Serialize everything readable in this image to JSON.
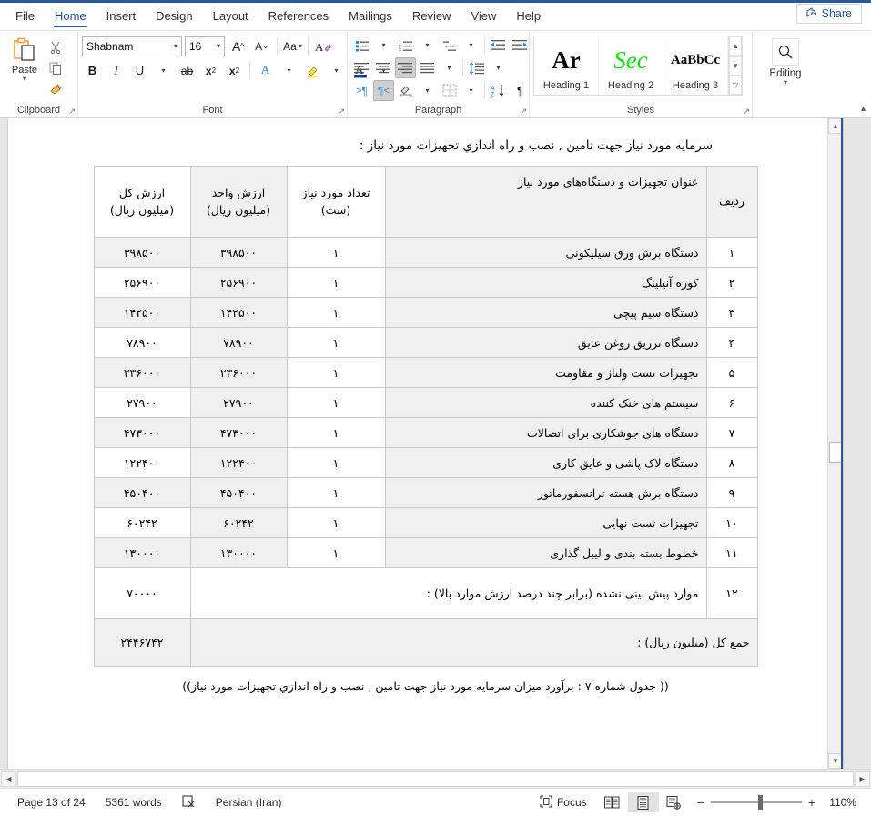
{
  "window": {
    "accent_color": "#2b579a",
    "share_label": "Share",
    "share_icon": "share-icon"
  },
  "tabs": [
    {
      "id": "file",
      "label": "File",
      "active": false
    },
    {
      "id": "home",
      "label": "Home",
      "active": true
    },
    {
      "id": "insert",
      "label": "Insert",
      "active": false
    },
    {
      "id": "design",
      "label": "Design",
      "active": false
    },
    {
      "id": "layout",
      "label": "Layout",
      "active": false
    },
    {
      "id": "references",
      "label": "References",
      "active": false
    },
    {
      "id": "mailings",
      "label": "Mailings",
      "active": false
    },
    {
      "id": "review",
      "label": "Review",
      "active": false
    },
    {
      "id": "view",
      "label": "View",
      "active": false
    },
    {
      "id": "help",
      "label": "Help",
      "active": false
    }
  ],
  "ribbon": {
    "clipboard": {
      "group_label": "Clipboard",
      "paste_label": "Paste",
      "cut_icon": "scissors-icon",
      "copy_icon": "copy-icon",
      "format_painter_icon": "format-painter-icon"
    },
    "font": {
      "group_label": "Font",
      "font_name": "Shabnam",
      "font_size": "16",
      "grow_font": "A^",
      "shrink_font": "Aˇ",
      "change_case": "Aa",
      "clear_formatting_icon": "clear-formatting-icon",
      "bold": "B",
      "italic": "I",
      "underline": "U",
      "strikethrough": "ab",
      "subscript": "x",
      "superscript": "x",
      "text_effects_icon": "text-effects-icon",
      "highlight_icon": "highlight-icon",
      "font_color_icon": "font-color-icon"
    },
    "paragraph": {
      "group_label": "Paragraph",
      "bullets_icon": "bullet-list-icon",
      "numbering_icon": "numbered-list-icon",
      "multilevel_icon": "multilevel-list-icon",
      "decrease_indent_icon": "decrease-indent-icon",
      "increase_indent_icon": "increase-indent-icon",
      "align_left_icon": "align-left-icon",
      "align_center_icon": "align-center-icon",
      "align_right_icon": "align-right-icon",
      "justify_icon": "justify-icon",
      "line_spacing_icon": "line-spacing-icon",
      "ltr_icon": "left-to-right-icon",
      "rtl_icon": "right-to-left-icon",
      "shading_icon": "shading-icon",
      "borders_icon": "borders-icon",
      "sort_icon": "sort-icon",
      "show_marks_icon": "show-paragraph-marks-icon"
    },
    "styles": {
      "group_label": "Styles",
      "items": [
        {
          "preview": "Ar",
          "name": "Heading 1"
        },
        {
          "preview": "Sec",
          "name": "Heading 2"
        },
        {
          "preview": "AaBbCc",
          "name": "Heading 3"
        }
      ]
    },
    "editing": {
      "group_label": "",
      "label": "Editing",
      "icon": "search-icon"
    }
  },
  "document": {
    "title_text": "سرمایه مورد نیاز جهت تامین , نصب و راه اندازي تجهیزات مورد نیاز :",
    "caption": "(( جدول شماره ۷ : برآورد میزان سرمایه مورد نیاز جهت تامین , نصب و راه اندازي تجهیزات مورد نیاز))",
    "table": {
      "headers": {
        "radif": "ردیف",
        "title": "عنوان تجهیزات و دستگاه‌های مورد نیاز",
        "count": "تعداد مورد نیاز (ست)",
        "unit_value": "ارزش واحد (میلیون ریال)",
        "total_value": "ارزش کل (میلیون ریال)"
      },
      "rows": [
        {
          "radif": "۱",
          "title": "دستگاه برش ورق سیلیکونی",
          "count": "۱",
          "unit": "۳۹۸۵۰۰",
          "total": "۳۹۸۵۰۰"
        },
        {
          "radif": "۲",
          "title": "کوره آنیلینگ",
          "count": "۱",
          "unit": "۲۵۶۹۰۰",
          "total": "۲۵۶۹۰۰"
        },
        {
          "radif": "۳",
          "title": "دستگاه سیم پیچی",
          "count": "۱",
          "unit": "۱۴۲۵۰۰",
          "total": "۱۴۲۵۰۰"
        },
        {
          "radif": "۴",
          "title": "دستگاه تزریق روغن عایق",
          "count": "۱",
          "unit": "۷۸۹۰۰",
          "total": "۷۸۹۰۰"
        },
        {
          "radif": "۵",
          "title": "تجهیزات تست ولتاژ و مقاومت",
          "count": "۱",
          "unit": "۲۳۶۰۰۰",
          "total": "۲۳۶۰۰۰"
        },
        {
          "radif": "۶",
          "title": "سیستم های خنک کننده",
          "count": "۱",
          "unit": "۲۷۹۰۰",
          "total": "۲۷۹۰۰"
        },
        {
          "radif": "۷",
          "title": "دستگاه های جوشکاری برای اتصالات",
          "count": "۱",
          "unit": "۴۷۳۰۰۰",
          "total": "۴۷۳۰۰۰"
        },
        {
          "radif": "۸",
          "title": "دستگاه لاک پاشی و عایق کاری",
          "count": "۱",
          "unit": "۱۲۲۴۰۰",
          "total": "۱۲۲۴۰۰"
        },
        {
          "radif": "۹",
          "title": "دستگاه برش هسته ترانسفورماتور",
          "count": "۱",
          "unit": "۴۵۰۴۰۰",
          "total": "۴۵۰۴۰۰"
        },
        {
          "radif": "۱۰",
          "title": "تجهیزات تست نهایی",
          "count": "۱",
          "unit": "۶۰۲۴۲",
          "total": "۶۰۲۴۲"
        },
        {
          "radif": "۱۱",
          "title": "خطوط بسته بندی و لیبل گذاری",
          "count": "۱",
          "unit": "۱۳۰۰۰۰",
          "total": "۱۳۰۰۰۰"
        }
      ],
      "unforeseen_row": {
        "radif": "۱۲",
        "label": "موارد پیش بینی نشده (برابر چند درصد ارزش موارد بالا) :",
        "total": "۷۰۰۰۰"
      },
      "sum_row": {
        "label": "جمع کل (میلیون ریال) :",
        "total": "۲۴۴۶۷۴۲"
      }
    }
  },
  "status_bar": {
    "page": "Page 13 of 24",
    "words": "5361 words",
    "proofing_icon": "proofing-errors-icon",
    "language": "Persian (Iran)",
    "focus_label": "Focus",
    "focus_icon": "focus-mode-icon",
    "view_read_icon": "read-mode-icon",
    "view_print_icon": "print-layout-icon",
    "view_web_icon": "web-layout-icon",
    "zoom_out": "−",
    "zoom_in": "+",
    "zoom_level": "110%"
  }
}
